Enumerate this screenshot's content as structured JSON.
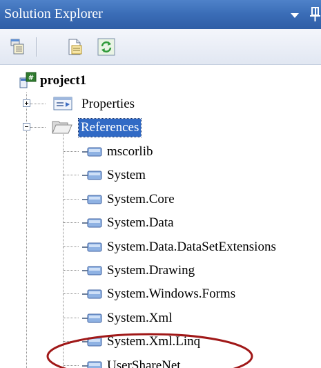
{
  "panel": {
    "title": "Solution Explorer",
    "dropdown_icon": "dropdown-arrow-icon",
    "pin_icon": "pin-icon"
  },
  "toolbar": {
    "buttons": [
      {
        "icon": "show-all-files-icon"
      },
      {
        "icon": "properties-icon"
      },
      {
        "icon": "refresh-icon"
      }
    ]
  },
  "tree": {
    "project": {
      "label": "project1",
      "icon": "csharp-project-icon"
    },
    "properties": {
      "label": "Properties",
      "icon": "properties-folder-icon",
      "expander": "+"
    },
    "references": {
      "label": "References",
      "icon": "open-folder-icon",
      "expander": "-",
      "selected": true
    },
    "reference_items": [
      {
        "label": "mscorlib"
      },
      {
        "label": "System"
      },
      {
        "label": "System.Core"
      },
      {
        "label": "System.Data"
      },
      {
        "label": "System.Data.DataSetExtensions"
      },
      {
        "label": "System.Drawing"
      },
      {
        "label": "System.Windows.Forms"
      },
      {
        "label": "System.Xml"
      },
      {
        "label": "System.Xml.Linq"
      },
      {
        "label": "UserShareNet"
      }
    ]
  },
  "colors": {
    "titlebar": "#3a6cb6",
    "selection": "#316ac5",
    "highlight_ellipse": "#a01818"
  }
}
